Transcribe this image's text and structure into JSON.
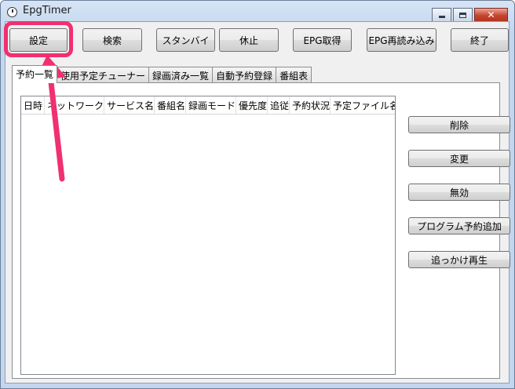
{
  "window": {
    "title": "EpgTimer",
    "icons": {
      "app": "clock-icon",
      "minimize": "minimize-icon",
      "maximize": "maximize-icon",
      "close": "close-icon"
    }
  },
  "toolbar": {
    "settings": "設定",
    "search": "検索",
    "standby": "スタンバイ",
    "pause": "休止",
    "epg_acquire": "EPG取得",
    "epg_reload": "EPG再読み込み",
    "exit": "終了"
  },
  "tabs": {
    "reservation_list": "予約一覧",
    "tuner_usage": "使用予定チューナー",
    "recorded_list": "録画済み一覧",
    "auto_reservation": "自動予約登録",
    "program_guide": "番組表"
  },
  "reservation_table": {
    "columns": {
      "datetime": "日時",
      "network": "ネットワーク",
      "service": "サービス名",
      "program": "番組名",
      "rec_mode": "録画モード",
      "priority": "優先度",
      "follow": "追従",
      "status": "予約状況",
      "file": "予定ファイル名"
    },
    "rows": []
  },
  "side_buttons": {
    "delete": "削除",
    "change": "変更",
    "disable": "無効",
    "add_program": "プログラム予約追加",
    "chase_play": "追っかけ再生"
  },
  "annotation": {
    "highlight_color": "#f0306f",
    "target": "settings-button"
  }
}
